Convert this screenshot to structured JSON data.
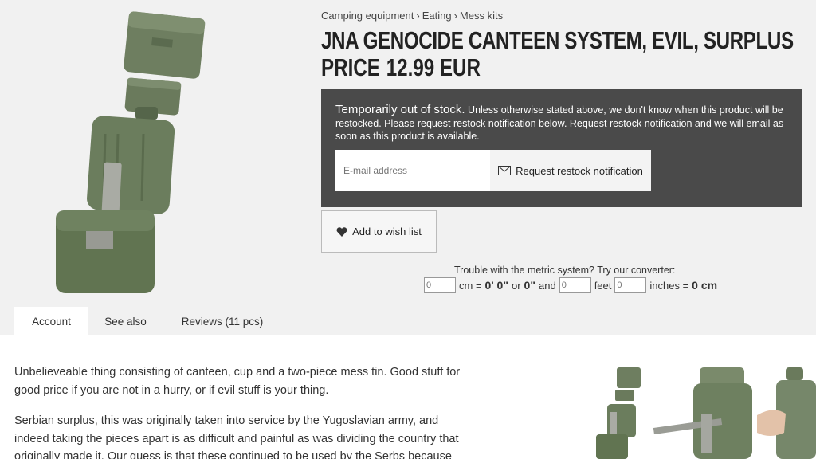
{
  "breadcrumb": [
    "Camping equipment",
    "Eating",
    "Mess kits"
  ],
  "product": {
    "title": "JNA GENOCIDE CANTEEN SYSTEM, EVIL, SURPLUS",
    "price_label": "PRICE",
    "price": "12.99 EUR"
  },
  "stock": {
    "lead": "Temporarily out of stock.",
    "message": " Unless otherwise stated above, we don't know when this product will be restocked. Please request restock notification below. Request restock notification and we will email as soon as this product is available.",
    "email_placeholder": "E-mail address",
    "restock_label": "Request restock notification"
  },
  "wishlist": {
    "label": "Add to wish list"
  },
  "converter": {
    "label": "Trouble with the metric system? Try our converter:",
    "cm_value": "0",
    "cm_unit": "cm =",
    "feet_inches_result": "0' 0\"",
    "or": "or",
    "inches_result": "0\"",
    "and": "and",
    "feet_value": "0",
    "feet_unit": "feet",
    "inches_value": "0",
    "inches_unit": "inches =",
    "cm_result": "0 cm"
  },
  "tabs": [
    "Account",
    "See also",
    "Reviews (11 pcs)"
  ],
  "description": {
    "p1": "Unbelieveable thing consisting of canteen, cup and a two-piece mess tin. Good stuff for good price if you are not in a hurry, or if evil stuff is your thing.",
    "p2": "Serbian surplus, this was originally taken into service by the Yugoslavian army, and indeed taking the pieces apart is as difficult and painful as was dividing the country that originally made it. Our guess is that these continued to be used by the Serbs because"
  },
  "colors": {
    "background": "#f1f1f1",
    "stock_box": "#4a4a4a",
    "canteen_green": "#6d7f5c"
  }
}
